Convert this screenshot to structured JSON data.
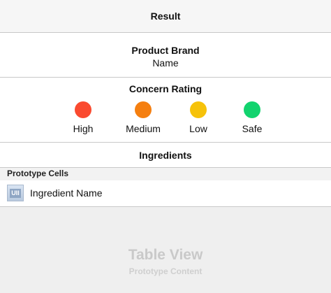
{
  "nav": {
    "title": "Result"
  },
  "brand": {
    "title": "Product Brand",
    "name": "Name"
  },
  "concern": {
    "title": "Concern Rating",
    "levels": [
      {
        "label": "High",
        "color": "#fa4a2f"
      },
      {
        "label": "Medium",
        "color": "#f57f10"
      },
      {
        "label": "Low",
        "color": "#f6c20a"
      },
      {
        "label": "Safe",
        "color": "#12d36e"
      }
    ]
  },
  "ingredients": {
    "title": "Ingredients"
  },
  "prototype": {
    "header": "Prototype Cells",
    "cell": {
      "icon": "ui-image-placeholder-icon",
      "icon_text": "UII",
      "label": "Ingredient Name"
    }
  },
  "placeholder": {
    "title": "Table View",
    "subtitle": "Prototype Content"
  }
}
